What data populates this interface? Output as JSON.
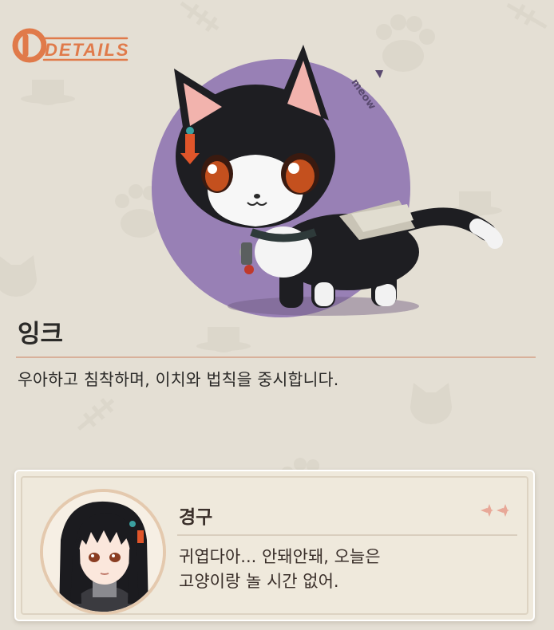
{
  "header": {
    "logo_text": "DETAILS"
  },
  "pet": {
    "name": "잉크",
    "description": "우아하고 침착하며, 이치와 법칙을 중시합니다.",
    "badge_text": "meow"
  },
  "dialogue": {
    "speaker": "경구",
    "lines": [
      "귀엽다아... 안돼안돼, 오늘은",
      "고양이랑 놀 시간 없어."
    ]
  },
  "colors": {
    "background": "#e4dfd4",
    "accent": "#e07a4a",
    "circle": "#9c84b8",
    "divider": "#d8b09a",
    "text": "#2b2a28"
  },
  "icons": [
    "details-logo",
    "black-cat-illustration",
    "character-portrait",
    "sparkle-icon"
  ]
}
